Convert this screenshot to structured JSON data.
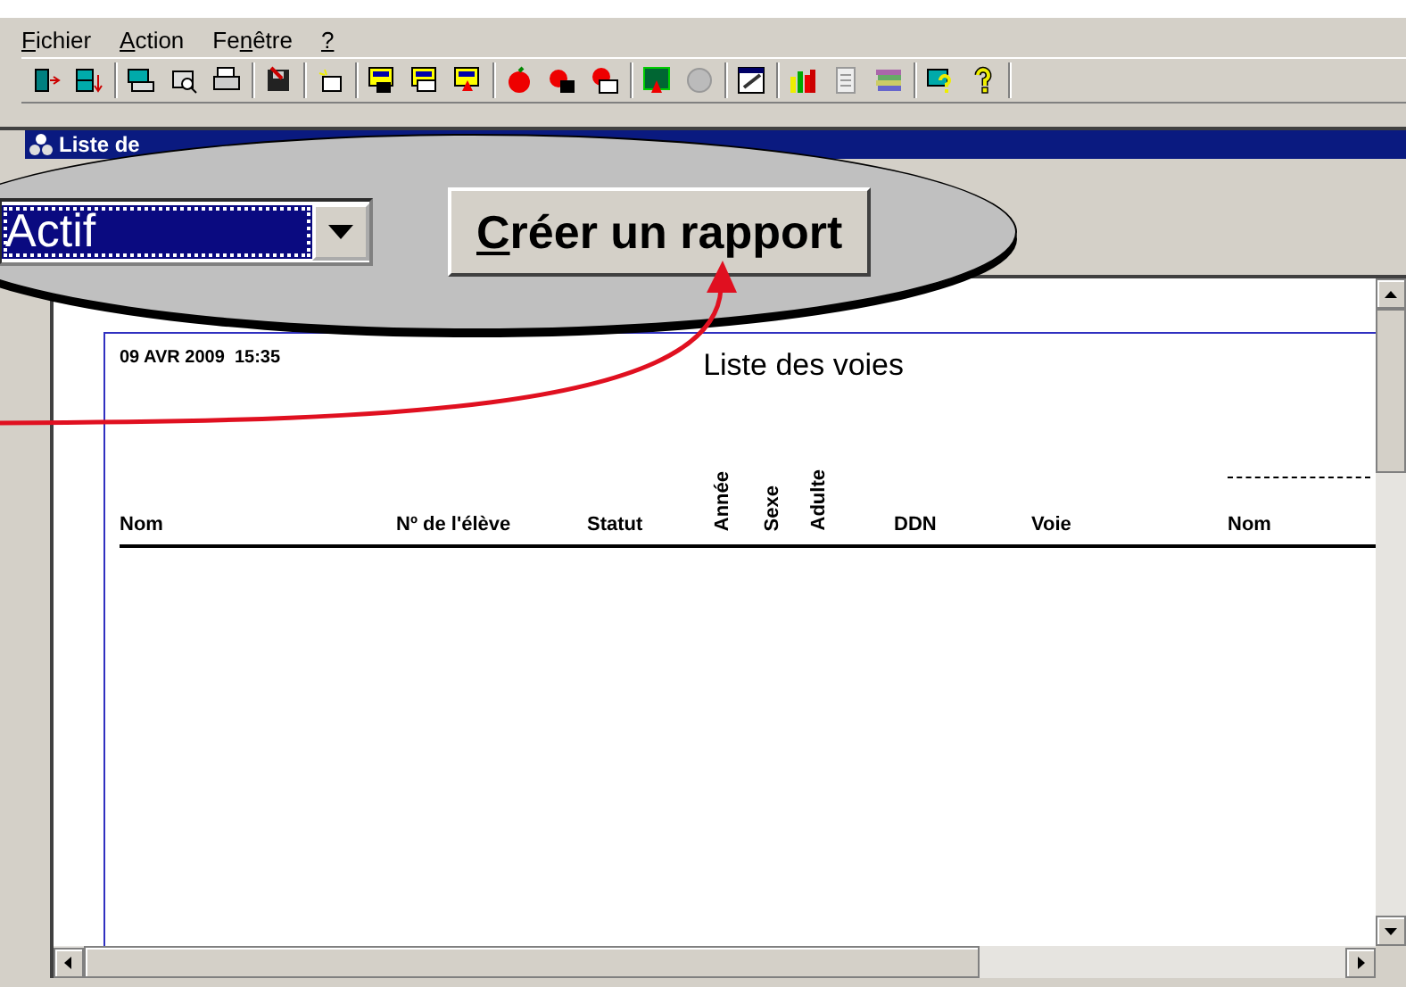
{
  "menu": [
    {
      "key": "F",
      "after": "ichier"
    },
    {
      "key": "A",
      "after": "ction"
    },
    {
      "before": "Fe",
      "key": "n",
      "after": "être"
    },
    {
      "key": "?"
    }
  ],
  "window": {
    "title": "Liste de"
  },
  "callout": {
    "filter": {
      "value": "Actif",
      "focused": true
    },
    "button": {
      "key": "C",
      "after": "réer un rapport"
    }
  },
  "report": {
    "timestamp": "09 AVR 2009  15:35",
    "title": "Liste des voies",
    "columns": [
      {
        "label": "Nom",
        "kind": "horizontal"
      },
      {
        "label": "Nº de l'élève",
        "kind": "horizontal"
      },
      {
        "label": "Statut",
        "kind": "horizontal"
      },
      {
        "label": "Année",
        "kind": "vertical"
      },
      {
        "label": "Sexe",
        "kind": "vertical"
      },
      {
        "label": "Adulte",
        "kind": "vertical"
      },
      {
        "label": "DDN",
        "kind": "horizontal"
      },
      {
        "label": "Voie",
        "kind": "horizontal"
      },
      {
        "label": "Nom",
        "kind": "horizontal",
        "overline": true
      }
    ]
  }
}
